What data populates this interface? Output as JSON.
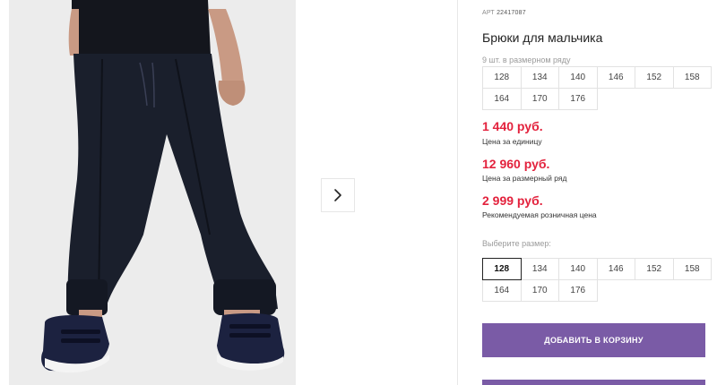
{
  "product": {
    "sku_label": "АРТ",
    "sku_number": "22417087",
    "title": "Брюки для мальчика",
    "series_note": "9 шт. в размерном ряду"
  },
  "series_sizes": [
    "128",
    "134",
    "140",
    "146",
    "152",
    "158",
    "164",
    "170",
    "176"
  ],
  "prices": {
    "unit_price": "1 440 руб.",
    "unit_label": "Цена за единицу",
    "series_price": "12 960 руб.",
    "series_label": "Цена за размерный ряд",
    "retail_price": "2 999 руб.",
    "retail_label": "Рекомендуемая розничная цена"
  },
  "size_picker": {
    "label": "Выберите размер:",
    "sizes": [
      "128",
      "134",
      "140",
      "146",
      "152",
      "158",
      "164",
      "170",
      "176"
    ],
    "selected": "128"
  },
  "actions": {
    "add_to_cart": "ДОБАВИТЬ В КОРЗИНУ"
  },
  "colors": {
    "price_red": "#e3223d",
    "button_purple": "#7a5ba6"
  },
  "icons": {
    "next": "chevron-right-icon"
  }
}
